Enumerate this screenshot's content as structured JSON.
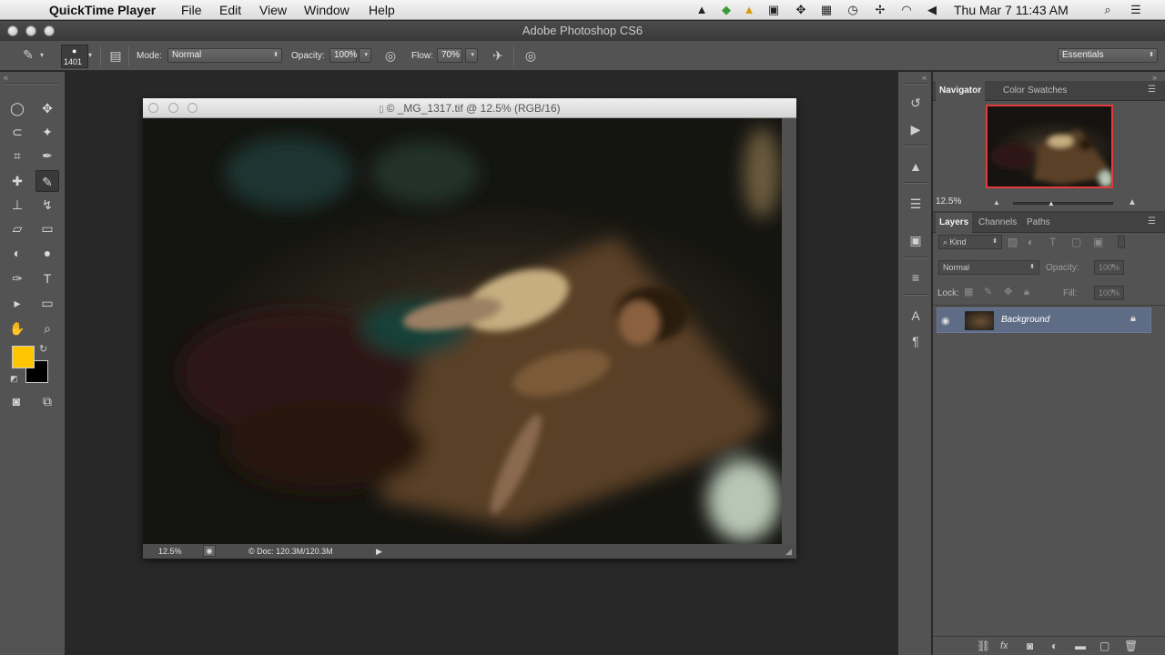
{
  "menubar": {
    "app_name": "QuickTime Player",
    "menus": [
      "File",
      "Edit",
      "View",
      "Window",
      "Help"
    ],
    "clock": "Thu Mar 7  11:43 AM"
  },
  "window": {
    "title": "Adobe Photoshop CS6"
  },
  "options": {
    "brush_size": "1401",
    "mode_label": "Mode:",
    "mode_value": "Normal",
    "opacity_label": "Opacity:",
    "opacity_value": "100%",
    "flow_label": "Flow:",
    "flow_value": "70%",
    "workspace": "Essentials"
  },
  "colors": {
    "foreground": "#ffc500",
    "background": "#000000"
  },
  "document": {
    "title": "© _MG_1317.tif @ 12.5% (RGB/16)",
    "zoom": "12.5%",
    "doc_info": "© Doc: 120.3M/120.3M"
  },
  "navigator": {
    "tabs": [
      "Navigator",
      "Color",
      "Swatches"
    ],
    "zoom": "12.5%"
  },
  "layers": {
    "tabs": [
      "Layers",
      "Channels",
      "Paths"
    ],
    "filter_kind": "Kind",
    "blend_mode": "Normal",
    "opacity_label": "Opacity:",
    "opacity_value": "100%",
    "lock_label": "Lock:",
    "fill_label": "Fill:",
    "fill_value": "100%",
    "items": [
      {
        "name": "Background"
      }
    ]
  }
}
